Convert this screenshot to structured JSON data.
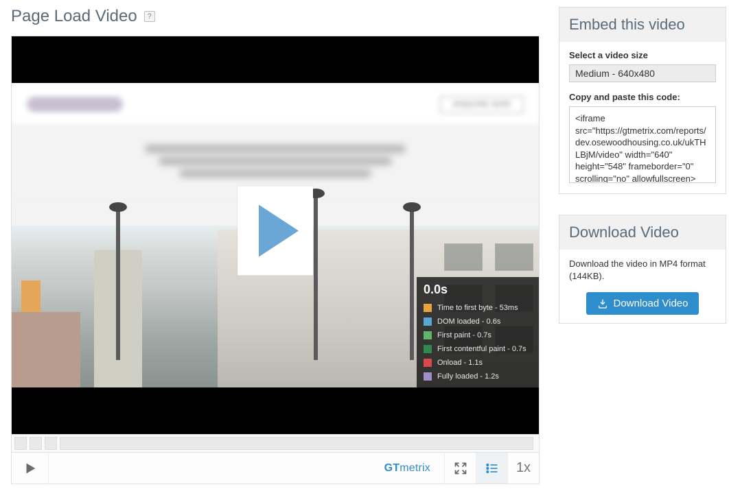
{
  "header": {
    "title": "Page Load Video",
    "help_tooltip": "?"
  },
  "video": {
    "site_button_label": "ENQUIRE NOW",
    "legend": {
      "time": "0.0s",
      "items": [
        {
          "color": "#e6a43a",
          "label": "Time to first byte - 53ms"
        },
        {
          "color": "#5aa7d6",
          "label": "DOM loaded - 0.6s"
        },
        {
          "color": "#5fb56a",
          "label": "First paint - 0.7s"
        },
        {
          "color": "#2f8a4b",
          "label": "First contentful paint - 0.7s"
        },
        {
          "color": "#d94a4a",
          "label": "Onload - 1.1s"
        },
        {
          "color": "#9f8fc7",
          "label": "Fully loaded - 1.2s"
        }
      ]
    }
  },
  "controls": {
    "brand_prefix": "GT",
    "brand_suffix": "metrix",
    "speed": "1x"
  },
  "embed": {
    "panel_title": "Embed this video",
    "size_label": "Select a video size",
    "size_value": "Medium - 640x480",
    "code_label": "Copy and paste this code:",
    "code_value": "<iframe src=\"https://gtmetrix.com/reports/dev.osewoodhousing.co.uk/ukTHLBjM/video\" width=\"640\" height=\"548\" frameborder=\"0\" scrolling=\"no\" allowfullscreen></iframe>"
  },
  "download": {
    "panel_title": "Download Video",
    "text": "Download the video in MP4 format (144KB).",
    "button_label": "Download Video"
  }
}
